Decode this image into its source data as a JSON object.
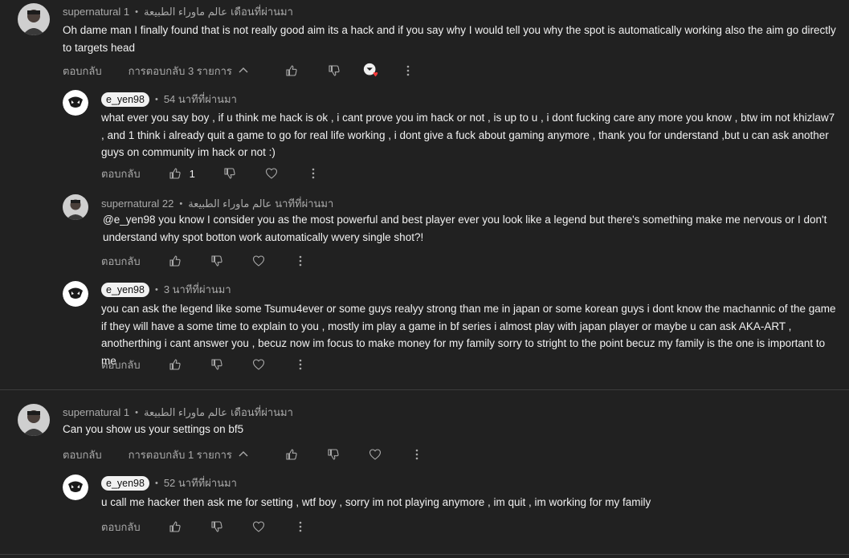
{
  "labels": {
    "reply": "ตอบกลับ",
    "dot": "•"
  },
  "colors": {
    "background": "#212121",
    "text": "#f1f1f1",
    "muted": "#aaaaaa",
    "heart_red": "#ff3b3b"
  },
  "threads": [
    {
      "author": "supernatural 1",
      "channel": "عالم ماوراء الطبيعة",
      "time": "เดือนที่ผ่านมา",
      "text": "Oh dame man I finally found that is not  really good aim its a hack and if you say why I would tell you why the spot is automatically working also  the aim go directly to targets head",
      "replies_label": "การตอบกลับ 3 รายการ",
      "replies": [
        {
          "author": "e_yen98",
          "time": "54 นาทีที่ผ่านมา",
          "text": "what ever you say boy , if u think me hack is ok , i cant prove you im hack or not , is up to u , i dont fucking care any more you know , btw im not khizlaw7 , and 1 think i already quit a game to go for real life working , i dont give a fuck about gaming anymore , thank you for understand ,but u can ask another guys on community im hack or not :)",
          "likes": "1"
        },
        {
          "author": "supernatural 22",
          "channel": "عالم ماوراء الطبيعة",
          "time": "นาทีที่ผ่านมา",
          "mention": "@e_yen98",
          "text": "  you know I consider you as the most powerful and best player ever you look like a legend but there's something make me nervous or I don't understand why spot botton work automatically wvery single shot?!"
        },
        {
          "author": "e_yen98",
          "time": "3 นาทีที่ผ่านมา",
          "text": "you can ask the legend like some Tsumu4ever or some guys realyy strong than me in japan or some korean guys i dont know the machannic of the game if they will have a some time to explain to you , mostly im play a game in bf series i almost play with japan player or maybe u can ask AKA-ART , anotherthing i cant answer you , becuz now im focus to make money for my family  sorry to stright to the point becuz my family is the one is important to me"
        }
      ]
    },
    {
      "author": "supernatural 1",
      "channel": "عالم ماوراء الطبيعة",
      "time": "เดือนที่ผ่านมา",
      "text": "Can you show us your settings on bf5",
      "replies_label": "การตอบกลับ 1 รายการ",
      "replies": [
        {
          "author": "e_yen98",
          "time": "52 นาทีที่ผ่านมา",
          "text": "u call me hacker then ask me for setting , wtf boy , sorry im not playing anymore , im quit , im working for my family"
        }
      ]
    }
  ]
}
